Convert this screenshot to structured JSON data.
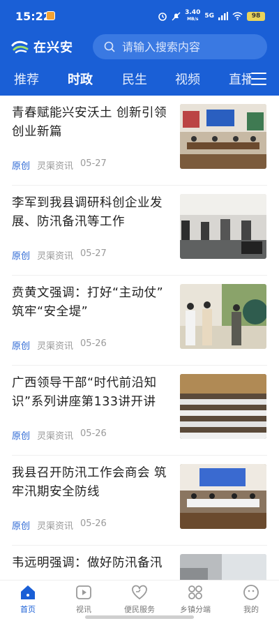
{
  "status": {
    "time": "15:22",
    "speed_top": "3.40",
    "speed_bottom": "MB/s",
    "network": "5G",
    "battery": "98"
  },
  "brand": {
    "name": "在兴安"
  },
  "search": {
    "placeholder": "请输入搜索内容"
  },
  "tabs": [
    {
      "label": "推荐"
    },
    {
      "label": "时政",
      "active": true
    },
    {
      "label": "民生"
    },
    {
      "label": "视频"
    },
    {
      "label": "直播"
    }
  ],
  "articles": [
    {
      "title": "青春赋能兴安沃土 创新引领创业新篇",
      "tag": "原创",
      "source": "灵渠资讯",
      "date": "05-27"
    },
    {
      "title": "李军到我县调研科创企业发展、防汛备汛等工作",
      "tag": "原创",
      "source": "灵渠资讯",
      "date": "05-27"
    },
    {
      "title": "贲黄文强调：打好“主动仗” 筑牢“安全堤”",
      "tag": "原创",
      "source": "灵渠资讯",
      "date": "05-26"
    },
    {
      "title": "广西领导干部“时代前沿知识”系列讲座第133讲开讲",
      "tag": "原创",
      "source": "灵渠资讯",
      "date": "05-26"
    },
    {
      "title": "我县召开防汛工作会商会 筑牢汛期安全防线",
      "tag": "原创",
      "source": "灵渠资讯",
      "date": "05-26"
    },
    {
      "title": "韦远明强调：做好防汛备汛",
      "tag": "",
      "source": "",
      "date": ""
    }
  ],
  "bottom_nav": [
    {
      "label": "首页",
      "icon": "home-icon",
      "active": true
    },
    {
      "label": "视讯",
      "icon": "play-icon"
    },
    {
      "label": "便民服务",
      "icon": "heart-service-icon"
    },
    {
      "label": "乡镇分端",
      "icon": "grid-icon"
    },
    {
      "label": "我的",
      "icon": "profile-icon"
    }
  ],
  "colors": {
    "brand_blue": "#1a5fd6",
    "tag_blue": "#2b67d4"
  }
}
